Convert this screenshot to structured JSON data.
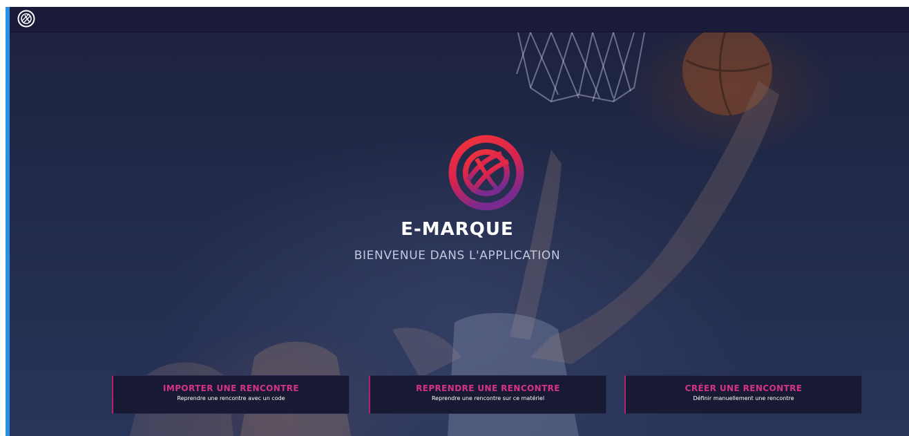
{
  "app": {
    "title": "E-MARQUE",
    "subtitle": "BIENVENUE DANS L'APPLICATION"
  },
  "actions": [
    {
      "title": "IMPORTER UNE RENCONTRE",
      "description": "Reprendre une rencontre avec un code"
    },
    {
      "title": "REPRENDRE UNE RENCONTRE",
      "description": "Reprendre une rencontre sur ce matériel"
    },
    {
      "title": "CRÉER UNE RENCONTRE",
      "description": "Définir manuellement une rencontre"
    }
  ],
  "colors": {
    "accent": "#d63384",
    "topbar": "#1a1b3a",
    "left_accent": "#2b8fe6",
    "card_bg": "#181a33"
  },
  "icons": {
    "topbar_logo": "basketball-logo-icon",
    "brand_logo": "basketball-brand-logo-icon"
  }
}
